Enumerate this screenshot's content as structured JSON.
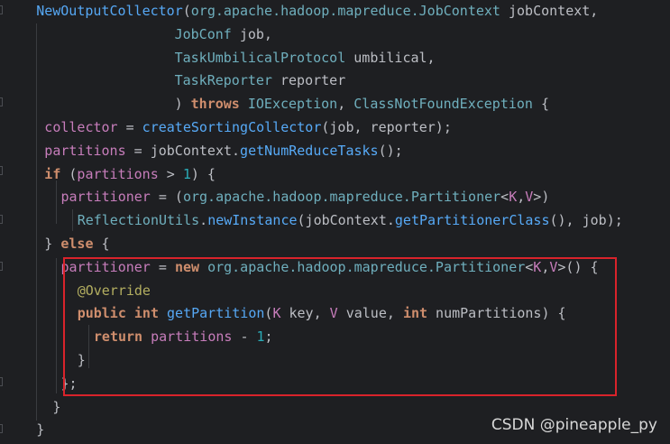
{
  "code_lines": [
    {
      "indent": 2,
      "tokens": [
        {
          "t": "NewOutputCollector",
          "c": "method"
        },
        {
          "t": "(",
          "c": "plain"
        },
        {
          "t": "org.apache.hadoop.mapreduce.JobContext",
          "c": "class"
        },
        {
          "t": " jobContext,",
          "c": "plain"
        }
      ]
    },
    {
      "indent": 0,
      "tokens": [
        {
          "t": "                   ",
          "c": "plain"
        },
        {
          "t": "JobConf",
          "c": "class"
        },
        {
          "t": " job,",
          "c": "plain"
        }
      ]
    },
    {
      "indent": 0,
      "tokens": [
        {
          "t": "                   ",
          "c": "plain"
        },
        {
          "t": "TaskUmbilicalProtocol",
          "c": "class"
        },
        {
          "t": " umbilical,",
          "c": "plain"
        }
      ]
    },
    {
      "indent": 0,
      "tokens": [
        {
          "t": "                   ",
          "c": "plain"
        },
        {
          "t": "TaskReporter",
          "c": "class"
        },
        {
          "t": " reporter",
          "c": "plain"
        }
      ]
    },
    {
      "indent": 0,
      "tokens": [
        {
          "t": "                   ",
          "c": "plain"
        },
        {
          "t": ") ",
          "c": "plain"
        },
        {
          "t": "throws",
          "c": "kw"
        },
        {
          "t": " ",
          "c": "plain"
        },
        {
          "t": "IOException",
          "c": "class"
        },
        {
          "t": ", ",
          "c": "plain"
        },
        {
          "t": "ClassNotFoundException",
          "c": "class"
        },
        {
          "t": " {",
          "c": "plain"
        }
      ]
    },
    {
      "indent": 3,
      "tokens": [
        {
          "t": "collector",
          "c": "field"
        },
        {
          "t": " = ",
          "c": "plain"
        },
        {
          "t": "createSortingCollector",
          "c": "call"
        },
        {
          "t": "(job, reporter);",
          "c": "plain"
        }
      ]
    },
    {
      "indent": 3,
      "tokens": [
        {
          "t": "partitions",
          "c": "field"
        },
        {
          "t": " = jobContext.",
          "c": "plain"
        },
        {
          "t": "getNumReduceTasks",
          "c": "call"
        },
        {
          "t": "();",
          "c": "plain"
        }
      ]
    },
    {
      "indent": 3,
      "tokens": [
        {
          "t": "if",
          "c": "kw"
        },
        {
          "t": " (",
          "c": "plain"
        },
        {
          "t": "partitions",
          "c": "field"
        },
        {
          "t": " > ",
          "c": "plain"
        },
        {
          "t": "1",
          "c": "num"
        },
        {
          "t": ") {",
          "c": "plain"
        }
      ]
    },
    {
      "indent": 5,
      "tokens": [
        {
          "t": "partitioner",
          "c": "field"
        },
        {
          "t": " = (",
          "c": "plain"
        },
        {
          "t": "org.apache.hadoop.mapreduce.Partitioner",
          "c": "class"
        },
        {
          "t": "<",
          "c": "plain"
        },
        {
          "t": "K",
          "c": "type"
        },
        {
          "t": ",",
          "c": "plain"
        },
        {
          "t": "V",
          "c": "type"
        },
        {
          "t": ">)",
          "c": "plain"
        }
      ]
    },
    {
      "indent": 7,
      "tokens": [
        {
          "t": "ReflectionUtils",
          "c": "class"
        },
        {
          "t": ".",
          "c": "plain"
        },
        {
          "t": "newInstance",
          "c": "call"
        },
        {
          "t": "(jobContext.",
          "c": "plain"
        },
        {
          "t": "getPartitionerClass",
          "c": "call"
        },
        {
          "t": "(), job);",
          "c": "plain"
        }
      ]
    },
    {
      "indent": 3,
      "tokens": [
        {
          "t": "} ",
          "c": "plain"
        },
        {
          "t": "else",
          "c": "kw"
        },
        {
          "t": " {",
          "c": "plain"
        }
      ]
    },
    {
      "indent": 5,
      "tokens": [
        {
          "t": "partitioner",
          "c": "field"
        },
        {
          "t": " = ",
          "c": "plain"
        },
        {
          "t": "new",
          "c": "kw"
        },
        {
          "t": " ",
          "c": "plain"
        },
        {
          "t": "org.apache.hadoop.mapreduce.Partitioner",
          "c": "class"
        },
        {
          "t": "<",
          "c": "plain"
        },
        {
          "t": "K",
          "c": "type"
        },
        {
          "t": ",",
          "c": "plain"
        },
        {
          "t": "V",
          "c": "type"
        },
        {
          "t": ">() {",
          "c": "plain"
        }
      ]
    },
    {
      "indent": 7,
      "tokens": [
        {
          "t": "@Override",
          "c": "anno"
        }
      ]
    },
    {
      "indent": 7,
      "tokens": [
        {
          "t": "public",
          "c": "kw"
        },
        {
          "t": " ",
          "c": "plain"
        },
        {
          "t": "int",
          "c": "kw"
        },
        {
          "t": " ",
          "c": "plain"
        },
        {
          "t": "getPartition",
          "c": "method"
        },
        {
          "t": "(",
          "c": "plain"
        },
        {
          "t": "K",
          "c": "type"
        },
        {
          "t": " key, ",
          "c": "plain"
        },
        {
          "t": "V",
          "c": "type"
        },
        {
          "t": " value, ",
          "c": "plain"
        },
        {
          "t": "int",
          "c": "kw"
        },
        {
          "t": " numPartitions) {",
          "c": "plain"
        }
      ]
    },
    {
      "indent": 9,
      "tokens": [
        {
          "t": "return",
          "c": "kw"
        },
        {
          "t": " ",
          "c": "plain"
        },
        {
          "t": "partitions",
          "c": "field"
        },
        {
          "t": " - ",
          "c": "plain"
        },
        {
          "t": "1",
          "c": "num"
        },
        {
          "t": ";",
          "c": "plain"
        }
      ]
    },
    {
      "indent": 7,
      "tokens": [
        {
          "t": "}",
          "c": "plain"
        }
      ]
    },
    {
      "indent": 5,
      "tokens": [
        {
          "t": "};",
          "c": "plain"
        }
      ]
    },
    {
      "indent": 4,
      "tokens": [
        {
          "t": "}",
          "c": "plain"
        }
      ]
    },
    {
      "indent": 2,
      "tokens": [
        {
          "t": "}",
          "c": "plain"
        }
      ]
    }
  ],
  "watermark": "CSDN @pineapple_py",
  "colors": {
    "background": "#1e1f22",
    "keyword": "#cf8e6d",
    "field": "#c77dbb",
    "method": "#56a8f5",
    "class": "#6fafbd",
    "number": "#2aacb8",
    "annotation": "#b3ae60",
    "highlight_box": "#d9232b"
  }
}
